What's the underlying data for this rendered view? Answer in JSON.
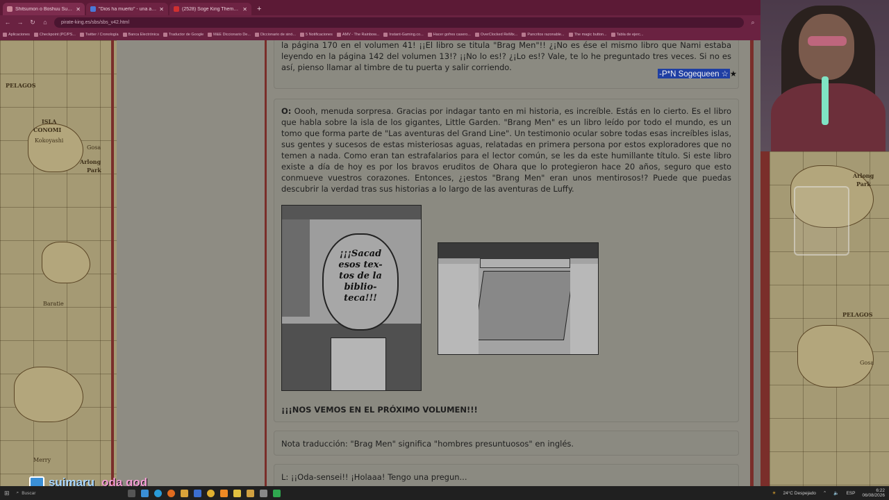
{
  "browser": {
    "tabs": [
      {
        "label": "Shitsumon o Boshuu Suru (SBS",
        "active": true
      },
      {
        "label": "\"Dios ha muerto\" - una absurda",
        "active": false
      },
      {
        "label": "(2528) Soge King Theme | One",
        "active": false
      }
    ],
    "url": "pirate-king.es/sbs/sbs_v42.html",
    "bookmarks": [
      "Aplicaciones",
      "Checkpoint (PC/PS...",
      "Twitter / Cronología",
      "Banca Electrónica",
      "Traductor de Google",
      "M&E Diccionario De...",
      "Diccionario de sinó...",
      "5 Notificaciones",
      "AMV - The Rainbow...",
      "Instant-Gaming.co...",
      "Hacer gofres casero...",
      "OverClocked ReMix...",
      "Pancritos razonable...",
      "The magic button...",
      "Tabla de ejerc..."
    ]
  },
  "map_labels": {
    "left": [
      "PELAGOS",
      "ISLA",
      "CONOMI",
      "Kokoyashi",
      "Gosa",
      "Arlong",
      "Park",
      "Baratie",
      "Merry"
    ],
    "right": [
      "Arlong",
      "Park",
      "PELAGOS",
      "Gosa"
    ]
  },
  "question_tail": "la página 170 en el volumen 41! ¡¡El libro se titula \"Brag Men\"!! ¿¡No es ése el mismo libro que Nami estaba leyendo en la página 142 del volumen 13!? ¡¡No lo es!? ¿¡Lo es!? Vale, te lo he preguntado tres veces. Si no es así, pienso llamar al timbre de tu puerta y salir corriendo.",
  "signature": "-P*N Sogequeen ☆",
  "signature_star": "★",
  "answer": {
    "prefix": "O:",
    "text": "Oooh, menuda sorpresa. Gracias por indagar tanto en mi historia, es increíble. Estás en lo cierto. Es el libro que habla sobre la isla de los gigantes, Little Garden. \"Brang Men\" es un libro leído por todo el mundo, es un tomo que forma parte de \"Las aventuras del Grand Line\". Un testimonio ocular sobre todas esas increíbles islas, sus gentes y sucesos de estas misteriosas aguas, relatadas en primera persona por estos exploradores que no temen a nada. Como eran tan estrafalarios para el lector común, se les da este humillante título. Si este libro existe a día de hoy es por los bravos eruditos de Ohara que lo protegieron hace 20 años, seguro que esto conmueve vuestros corazones. Entonces, ¿¡estos \"Brang Men\" eran unos mentirosos!? Puede que puedas descubrir la verdad tras sus historias a lo largo de las aventuras de Luffy."
  },
  "manga_bubble": "¡¡¡Sacad esos tex- tos de la biblio- teca!!!",
  "outro": "¡¡¡NOS VEMOS EN EL PRÓXIMO VOLUMEN!!!",
  "translation_note": "Nota traducción: \"Brag Men\" significa \"hombres presuntuosos\" en inglés.",
  "next_question": "L: ¡¡Oda-sensei!! ¡Holaaa! Tengo una pregun...",
  "stream_overlay": {
    "username": "suimaru",
    "message": "oda god"
  },
  "taskbar": {
    "search": "Buscar",
    "weather": "24°C Despejado",
    "lang": "ESP",
    "time": "6:22",
    "date": "06/08/2026"
  }
}
